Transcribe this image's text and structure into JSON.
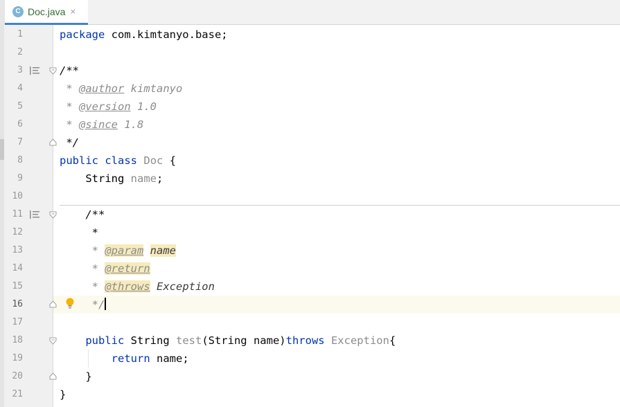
{
  "tab": {
    "icon_letter": "C",
    "label": "Doc.java",
    "close": "×"
  },
  "lines": [
    {
      "n": "1"
    },
    {
      "n": "2"
    },
    {
      "n": "3"
    },
    {
      "n": "4"
    },
    {
      "n": "5"
    },
    {
      "n": "6"
    },
    {
      "n": "7"
    },
    {
      "n": "8"
    },
    {
      "n": "9"
    },
    {
      "n": "10"
    },
    {
      "n": "11"
    },
    {
      "n": "12"
    },
    {
      "n": "13"
    },
    {
      "n": "14"
    },
    {
      "n": "15"
    },
    {
      "n": "16"
    },
    {
      "n": "17"
    },
    {
      "n": "18"
    },
    {
      "n": "19"
    },
    {
      "n": "20"
    },
    {
      "n": "21"
    }
  ],
  "code": {
    "l1_kw": "package",
    "l1_rest": " com.kimtanyo.base;",
    "l3": "/**",
    "l4_star": " * ",
    "l4_tag": "@author",
    "l4_val": " kimtanyo",
    "l5_star": " * ",
    "l5_tag": "@version",
    "l5_val": " 1.0",
    "l6_star": " * ",
    "l6_tag": "@since",
    "l6_val": " 1.8",
    "l7": " */",
    "l8_kw1": "public",
    "l8_kw2": "class",
    "l8_cls": "Doc",
    "l8_brace": " {",
    "l9_indent": "    ",
    "l9_type": "String",
    "l9_field": " name",
    "l9_semi": ";",
    "l11": "    /**",
    "l12": "     *",
    "l13_star": "     * ",
    "l13_tag": "@param",
    "l13_sp": " ",
    "l13_val": "name",
    "l14_star": "     * ",
    "l14_tag": "@return",
    "l15_star": "     * ",
    "l15_tag": "@throws",
    "l15_val": " Exception",
    "l16": "     */",
    "l18_indent": "    ",
    "l18_kw": "public",
    "l18_type": " String ",
    "l18_method": "test",
    "l18_params": "(String name)",
    "l18_throws": "throws",
    "l18_exc": " Exception",
    "l18_brace": "{",
    "l19_indent": "        ",
    "l19_kw": "return",
    "l19_rest": " name;",
    "l20": "    }",
    "l21": "}"
  }
}
